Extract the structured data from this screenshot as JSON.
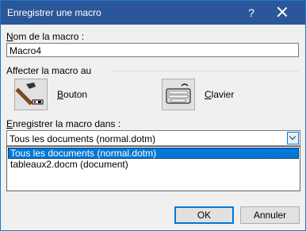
{
  "dialog": {
    "title": "Enregistrer une macro",
    "help_glyph": "?",
    "name_label_mnemonic": "N",
    "name_label_rest": "om de la macro :",
    "name_value": "Macro4",
    "assign_label": "Affecter la macro au",
    "button_mnemonic": "B",
    "button_rest": "outon",
    "keyboard_mnemonic": "C",
    "keyboard_rest": "lavier",
    "store_label_mnemonic": "E",
    "store_label_rest": "nregistrer la macro dans :",
    "store_selected": "Tous les documents (normal.dotm)",
    "store_options": [
      "Tous les documents (normal.dotm)",
      "tableaux2.docm (document)"
    ],
    "ok_label": "OK",
    "cancel_label": "Annuler"
  },
  "colors": {
    "titlebar": "#2b579a",
    "selection": "#0078d7",
    "accent_border": "#0078d7"
  },
  "icons": {
    "button": "hammer-icon",
    "keyboard": "keyboard-icon",
    "close": "close-icon",
    "dropdown": "chevron-down-icon"
  }
}
